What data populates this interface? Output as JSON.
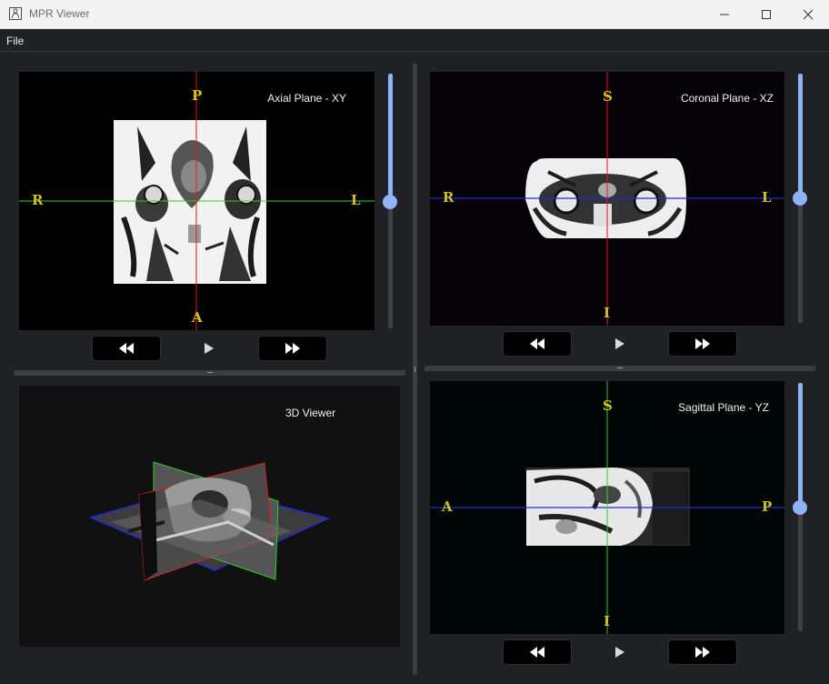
{
  "window": {
    "title": "MPR Viewer",
    "icon": "app-icon",
    "controls": [
      "minimize-icon",
      "maximize-icon",
      "close-icon"
    ]
  },
  "menu": {
    "file": "File"
  },
  "views": {
    "axial": {
      "title": "Axial Plane - XY",
      "top": "P",
      "bottom": "A",
      "left": "R",
      "right": "L",
      "slider_fraction": 0.5
    },
    "coronal": {
      "title": "Coronal Plane - XZ",
      "top": "S",
      "bottom": "I",
      "left": "R",
      "right": "L",
      "slider_fraction": 0.5
    },
    "viewer3d": {
      "title": "3D Viewer"
    },
    "sagittal": {
      "title": "Sagittal Plane - YZ",
      "top": "S",
      "bottom": "I",
      "left": "A",
      "right": "P",
      "slider_fraction": 0.5
    }
  },
  "controls": {
    "prev_icon": "rewind-icon",
    "play_icon": "play-icon",
    "next_icon": "fast-forward-icon"
  },
  "colors": {
    "accent": "#8fb3f5",
    "orientation_label": "#d4c21a",
    "crosshair_red": "#e01b1b",
    "crosshair_green": "#2ad02a",
    "crosshair_blue": "#1f2bd6"
  }
}
